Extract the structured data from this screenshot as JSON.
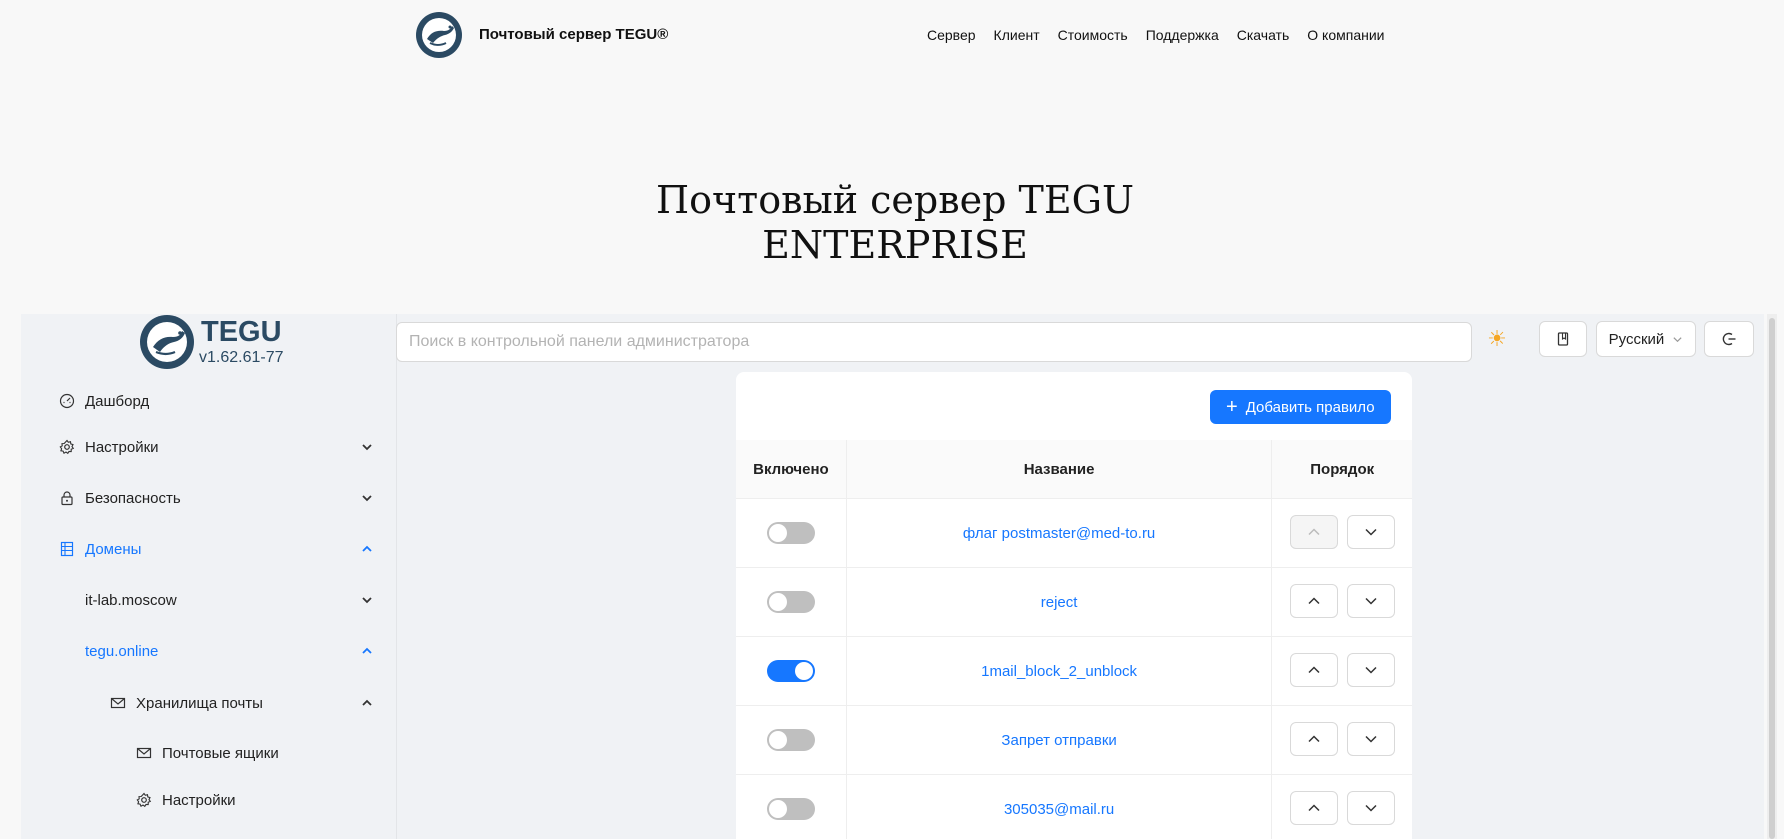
{
  "site": {
    "brand": "Почтовый сервер TEGU®",
    "nav": [
      "Сервер",
      "Клиент",
      "Стоимость",
      "Поддержка",
      "Скачать",
      "О компании"
    ],
    "hero_line1": "Почтовый сервер TEGU",
    "hero_line2": "ENTERPRISE"
  },
  "app": {
    "brand": "TEGU",
    "version": "v1.62.61-77",
    "search": {
      "placeholder": "Поиск в контрольной панели администратора",
      "value": ""
    },
    "language": "Русский",
    "colors": {
      "accent": "#1677ff",
      "brand": "#2b4a63"
    }
  },
  "sidebar": {
    "items": [
      {
        "label": "Дашборд",
        "icon": "dashboard-icon"
      },
      {
        "label": "Настройки",
        "icon": "gear-icon",
        "chevron": "down"
      },
      {
        "label": "Безопасность",
        "icon": "lock-icon",
        "chevron": "down"
      },
      {
        "label": "Домены",
        "icon": "domains-icon",
        "chevron": "up",
        "active": true
      },
      {
        "label": "it-lab.moscow",
        "chevron": "down"
      },
      {
        "label": "tegu.online",
        "chevron": "up",
        "active": true
      },
      {
        "label": "Хранилища почты",
        "icon": "mail-icon",
        "chevron": "up"
      },
      {
        "label": "Почтовые ящики",
        "icon": "mail-icon"
      },
      {
        "label": "Настройки",
        "icon": "gear-icon"
      }
    ]
  },
  "rules": {
    "add_label": "Добавить правило",
    "headers": {
      "enabled": "Включено",
      "name": "Название",
      "order": "Порядок"
    },
    "rows": [
      {
        "name": "флаг postmaster@med-to.ru",
        "enabled": false,
        "up_disabled": true
      },
      {
        "name": "reject",
        "enabled": false
      },
      {
        "name": "1mail_block_2_unblock",
        "enabled": true
      },
      {
        "name": "Запрет отправки",
        "enabled": false
      },
      {
        "name": "305035@mail.ru",
        "enabled": false
      }
    ]
  }
}
